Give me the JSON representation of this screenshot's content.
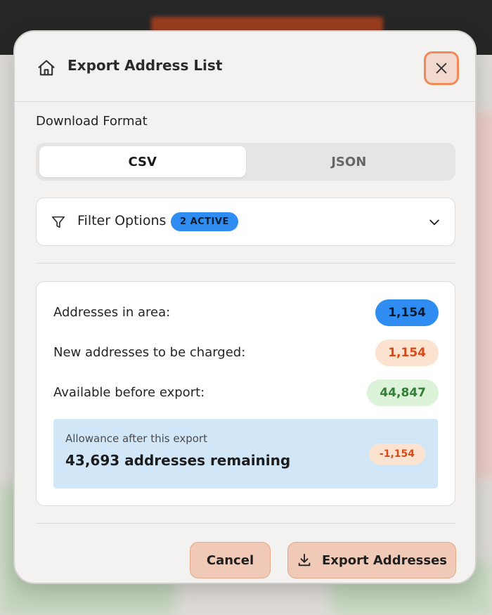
{
  "modal": {
    "title": "Export Address List",
    "close_icon": "close-icon",
    "home_icon": "home-icon"
  },
  "format": {
    "label": "Download Format",
    "options": [
      "CSV",
      "JSON"
    ],
    "selected": "CSV"
  },
  "filters": {
    "label": "Filter Options",
    "badge": "2 ACTIVE",
    "icon": "filter-icon"
  },
  "summary": {
    "rows": [
      {
        "label": "Addresses in area:",
        "value": "1,154",
        "color": "#2f8cf0"
      },
      {
        "label": "New addresses to be charged:",
        "value": "1,154",
        "color": "#d84a18"
      },
      {
        "label": "Available before export:",
        "value": "44,847",
        "color": "#2f7f34"
      }
    ],
    "allowance": {
      "caption": "Allowance after this export",
      "main": "43,693 addresses remaining",
      "delta": "-1,154"
    }
  },
  "actions": {
    "cancel": "Cancel",
    "export": "Export Addresses",
    "export_icon": "download-icon"
  },
  "colors": {
    "accent": "#f08a56",
    "badge_blue": "#2f8cf0",
    "allowance_bg": "#d1e7f8"
  }
}
